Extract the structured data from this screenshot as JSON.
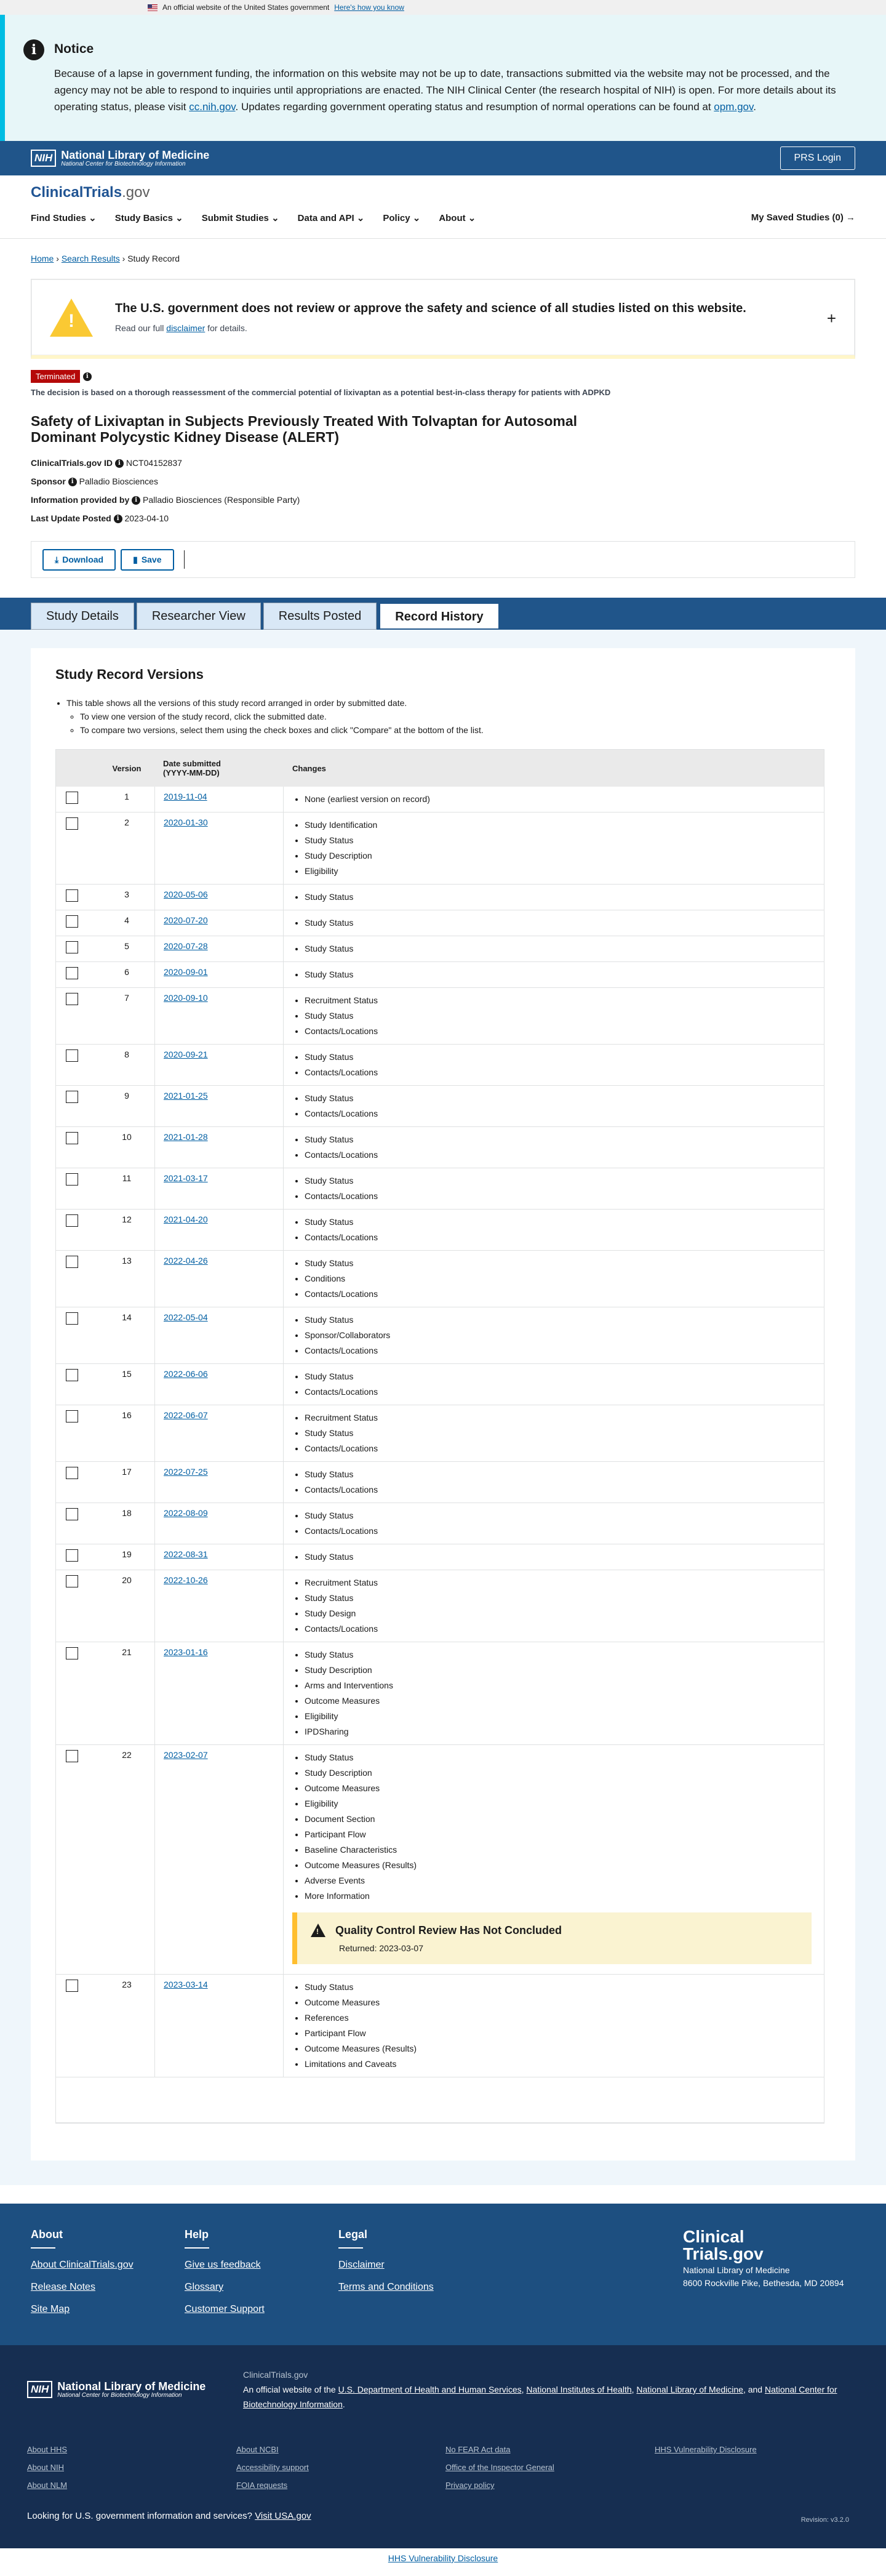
{
  "gov_banner": {
    "text": "An official website of the United States government",
    "link": "Here's how you know"
  },
  "notice": {
    "title": "Notice",
    "body_1": "Because of a lapse in government funding, the information on this website may not be up to date, transactions submitted via the website may not be processed, and the agency may not be able to respond to inquiries until appropriations are enacted. The NIH Clinical Center (the research hospital of NIH) is open. For more details about its operating status, please visit ",
    "link_1": "cc.nih.gov",
    "body_2": ". Updates regarding government operating status and resumption of normal operations can be found at ",
    "link_2": "opm.gov",
    "body_3": "."
  },
  "nlm": {
    "nih": "NIH",
    "title": "National Library of Medicine",
    "subtitle": "National Center for Biotechnology Information",
    "prs_login": "PRS Login"
  },
  "site": {
    "logo": "ClinicalTrials",
    "logo_suffix": ".gov"
  },
  "nav": {
    "items": [
      "Find Studies",
      "Study Basics",
      "Submit Studies",
      "Data and API",
      "Policy",
      "About"
    ],
    "saved": "My Saved Studies (0)"
  },
  "breadcrumb": {
    "home": "Home",
    "search": "Search Results",
    "current": "Study Record"
  },
  "disclaimer": {
    "title": "The U.S. government does not review or approve the safety and science of all studies listed on this website.",
    "text_1": "Read our full ",
    "link": "disclaimer",
    "text_2": " for details."
  },
  "study": {
    "status": "Terminated",
    "reason": "The decision is based on a thorough reassessment of the commercial potential of lixivaptan as a potential best-in-class therapy for patients with ADPKD",
    "title": "Safety of Lixivaptan in Subjects Previously Treated With Tolvaptan for Autosomal Dominant Polycystic Kidney Disease (ALERT)",
    "id_label": "ClinicalTrials.gov ID",
    "id": "NCT04152837",
    "sponsor_label": "Sponsor",
    "sponsor": "Palladio Biosciences",
    "provided_label": "Information provided by",
    "provided": "Palladio Biosciences (Responsible Party)",
    "updated_label": "Last Update Posted",
    "updated": "2023-04-10"
  },
  "actions": {
    "download": "Download",
    "save": "Save"
  },
  "tabs": [
    "Study Details",
    "Researcher View",
    "Results Posted",
    "Record History"
  ],
  "history": {
    "title": "Study Record Versions",
    "instr_1": "This table shows all the versions of this study record arranged in order by submitted date.",
    "instr_2": "To view one version of the study record, click the submitted date.",
    "instr_3": "To compare two versions, select them using the check boxes and click \"Compare\" at the bottom of the list.",
    "col_version": "Version",
    "col_date": "Date submitted",
    "col_date_fmt": "(YYYY-MM-DD)",
    "col_changes": "Changes",
    "rows": [
      {
        "v": "1",
        "d": "2019-11-04",
        "c": [
          "None (earliest version on record)"
        ]
      },
      {
        "v": "2",
        "d": "2020-01-30",
        "c": [
          "Study Identification",
          "Study Status",
          "Study Description",
          "Eligibility"
        ]
      },
      {
        "v": "3",
        "d": "2020-05-06",
        "c": [
          "Study Status"
        ]
      },
      {
        "v": "4",
        "d": "2020-07-20",
        "c": [
          "Study Status"
        ]
      },
      {
        "v": "5",
        "d": "2020-07-28",
        "c": [
          "Study Status"
        ]
      },
      {
        "v": "6",
        "d": "2020-09-01",
        "c": [
          "Study Status"
        ]
      },
      {
        "v": "7",
        "d": "2020-09-10",
        "c": [
          "Recruitment Status",
          "Study Status",
          "Contacts/Locations"
        ]
      },
      {
        "v": "8",
        "d": "2020-09-21",
        "c": [
          "Study Status",
          "Contacts/Locations"
        ]
      },
      {
        "v": "9",
        "d": "2021-01-25",
        "c": [
          "Study Status",
          "Contacts/Locations"
        ]
      },
      {
        "v": "10",
        "d": "2021-01-28",
        "c": [
          "Study Status",
          "Contacts/Locations"
        ]
      },
      {
        "v": "11",
        "d": "2021-03-17",
        "c": [
          "Study Status",
          "Contacts/Locations"
        ]
      },
      {
        "v": "12",
        "d": "2021-04-20",
        "c": [
          "Study Status",
          "Contacts/Locations"
        ]
      },
      {
        "v": "13",
        "d": "2022-04-26",
        "c": [
          "Study Status",
          "Conditions",
          "Contacts/Locations"
        ]
      },
      {
        "v": "14",
        "d": "2022-05-04",
        "c": [
          "Study Status",
          "Sponsor/Collaborators",
          "Contacts/Locations"
        ]
      },
      {
        "v": "15",
        "d": "2022-06-06",
        "c": [
          "Study Status",
          "Contacts/Locations"
        ]
      },
      {
        "v": "16",
        "d": "2022-06-07",
        "c": [
          "Recruitment Status",
          "Study Status",
          "Contacts/Locations"
        ]
      },
      {
        "v": "17",
        "d": "2022-07-25",
        "c": [
          "Study Status",
          "Contacts/Locations"
        ]
      },
      {
        "v": "18",
        "d": "2022-08-09",
        "c": [
          "Study Status",
          "Contacts/Locations"
        ]
      },
      {
        "v": "19",
        "d": "2022-08-31",
        "c": [
          "Study Status"
        ]
      },
      {
        "v": "20",
        "d": "2022-10-26",
        "c": [
          "Recruitment Status",
          "Study Status",
          "Study Design",
          "Contacts/Locations"
        ]
      },
      {
        "v": "21",
        "d": "2023-01-16",
        "c": [
          "Study Status",
          "Study Description",
          "Arms and Interventions",
          "Outcome Measures",
          "Eligibility",
          "IPDSharing"
        ]
      },
      {
        "v": "22",
        "d": "2023-02-07",
        "c": [
          "Study Status",
          "Study Description",
          "Outcome Measures",
          "Eligibility",
          "Document Section",
          "Participant Flow",
          "Baseline Characteristics",
          "Outcome Measures (Results)",
          "Adverse Events",
          "More Information"
        ],
        "qc": {
          "title": "Quality Control Review Has Not Concluded",
          "returned": "Returned: 2023-03-07"
        }
      },
      {
        "v": "23",
        "d": "2023-03-14",
        "c": [
          "Study Status",
          "Outcome Measures",
          "References",
          "Participant Flow",
          "Outcome Measures (Results)",
          "Limitations and Caveats"
        ]
      }
    ]
  },
  "footer": {
    "about_title": "About",
    "about_links": [
      "About ClinicalTrials.gov",
      "Release Notes",
      "Site Map"
    ],
    "help_title": "Help",
    "help_links": [
      "Give us feedback",
      "Glossary",
      "Customer Support"
    ],
    "legal_title": "Legal",
    "legal_links": [
      "Disclaimer",
      "Terms and Conditions"
    ],
    "brand_1": "Clinical",
    "brand_2": "Trials.gov",
    "org": "National Library of Medicine",
    "address": "8600 Rockville Pike, Bethesda, MD 20894",
    "site_name": "ClinicalTrials.gov",
    "official_1": "An official website of the ",
    "hhs": "U.S. Department of Health and Human Services",
    "nih": "National Institutes of Health",
    "nlm": "National Library of Medicine",
    "and": ", and ",
    "ncbi": "National Center for Biotechnology Information",
    "links": [
      "About HHS",
      "About NCBI",
      "No FEAR Act data",
      "HHS Vulnerability Disclosure",
      "About NIH",
      "Accessibility support",
      "Office of the Inspector General",
      "",
      "About NLM",
      "FOIA requests",
      "Privacy policy",
      ""
    ],
    "usa_text": "Looking for U.S. government information and services?",
    "usa_link": "Visit USA.gov",
    "revision": "Revision: v3.2.0",
    "bottom": "HHS Vulnerability Disclosure"
  }
}
